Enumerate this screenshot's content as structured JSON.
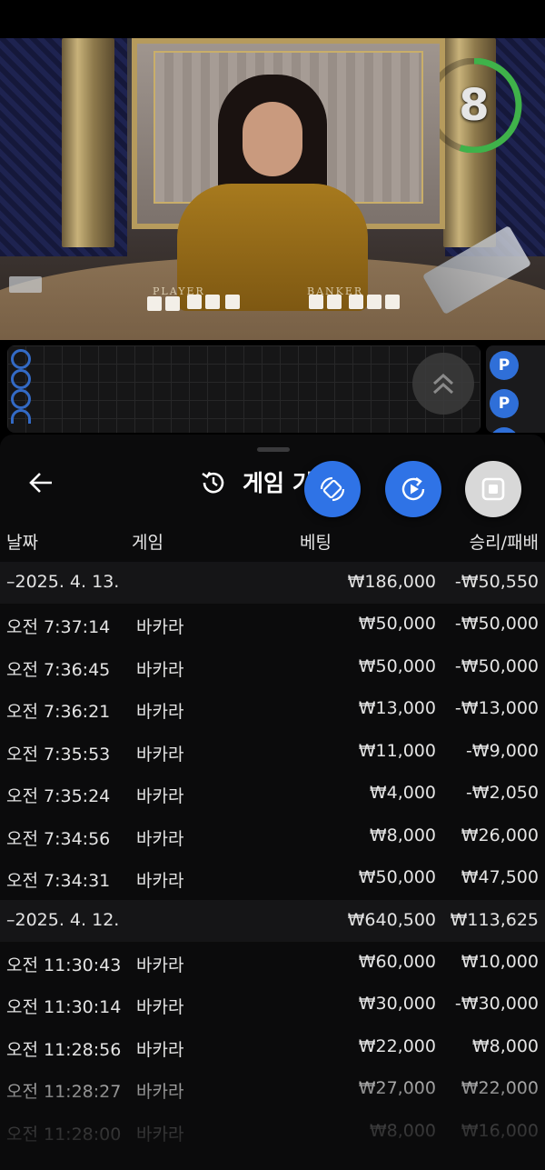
{
  "video": {
    "countdown": "8",
    "countdown_fraction": 0.55,
    "table_labels": {
      "player": "PLAYER",
      "banker": "BANKER"
    }
  },
  "roadmap": {
    "side_badges": [
      "P",
      "P",
      "P"
    ],
    "collapse_icon": "chevron-up-double-icon"
  },
  "history": {
    "title": "게임 기",
    "columns": {
      "date": "날짜",
      "game": "게임",
      "bet": "베팅",
      "result": "승리/패배"
    },
    "rows": [
      {
        "type": "date",
        "date": "–2025. 4. 13.",
        "bet": "₩186,000",
        "result": "-₩50,550"
      },
      {
        "type": "item",
        "time": "오전 7:37:14",
        "game": "바카라",
        "bet": "₩50,000",
        "result": "-₩50,000"
      },
      {
        "type": "item",
        "time": "오전 7:36:45",
        "game": "바카라",
        "bet": "₩50,000",
        "result": "-₩50,000"
      },
      {
        "type": "item",
        "time": "오전 7:36:21",
        "game": "바카라",
        "bet": "₩13,000",
        "result": "-₩13,000"
      },
      {
        "type": "item",
        "time": "오전 7:35:53",
        "game": "바카라",
        "bet": "₩11,000",
        "result": "-₩9,000"
      },
      {
        "type": "item",
        "time": "오전 7:35:24",
        "game": "바카라",
        "bet": "₩4,000",
        "result": "-₩2,050"
      },
      {
        "type": "item",
        "time": "오전 7:34:56",
        "game": "바카라",
        "bet": "₩8,000",
        "result": "₩26,000"
      },
      {
        "type": "item",
        "time": "오전 7:34:31",
        "game": "바카라",
        "bet": "₩50,000",
        "result": "₩47,500"
      },
      {
        "type": "date",
        "date": "–2025. 4. 12.",
        "bet": "₩640,500",
        "result": "₩113,625"
      },
      {
        "type": "item",
        "time": "오전 11:30:43",
        "game": "바카라",
        "bet": "₩60,000",
        "result": "₩10,000"
      },
      {
        "type": "item",
        "time": "오전 11:30:14",
        "game": "바카라",
        "bet": "₩30,000",
        "result": "-₩30,000"
      },
      {
        "type": "item",
        "time": "오전 11:28:56",
        "game": "바카라",
        "bet": "₩22,000",
        "result": "₩8,000"
      },
      {
        "type": "item",
        "time": "오전 11:28:27",
        "game": "바카라",
        "bet": "₩27,000",
        "result": "₩22,000"
      },
      {
        "type": "item",
        "time": "오전 11:28:00",
        "game": "바카라",
        "bet": "₩8,000",
        "result": "₩16,000"
      }
    ]
  },
  "icons": {
    "back": "arrow-left-icon",
    "history": "history-clock-icon",
    "fab_rotate": "rotate-screen-icon",
    "fab_replay": "replay-play-icon",
    "fab_stop": "stop-square-icon"
  },
  "colors": {
    "accent_blue": "#2f73e6",
    "timer_green": "#3fb24a",
    "sheet_bg": "#0b0b0c",
    "date_row_bg": "#151517"
  }
}
